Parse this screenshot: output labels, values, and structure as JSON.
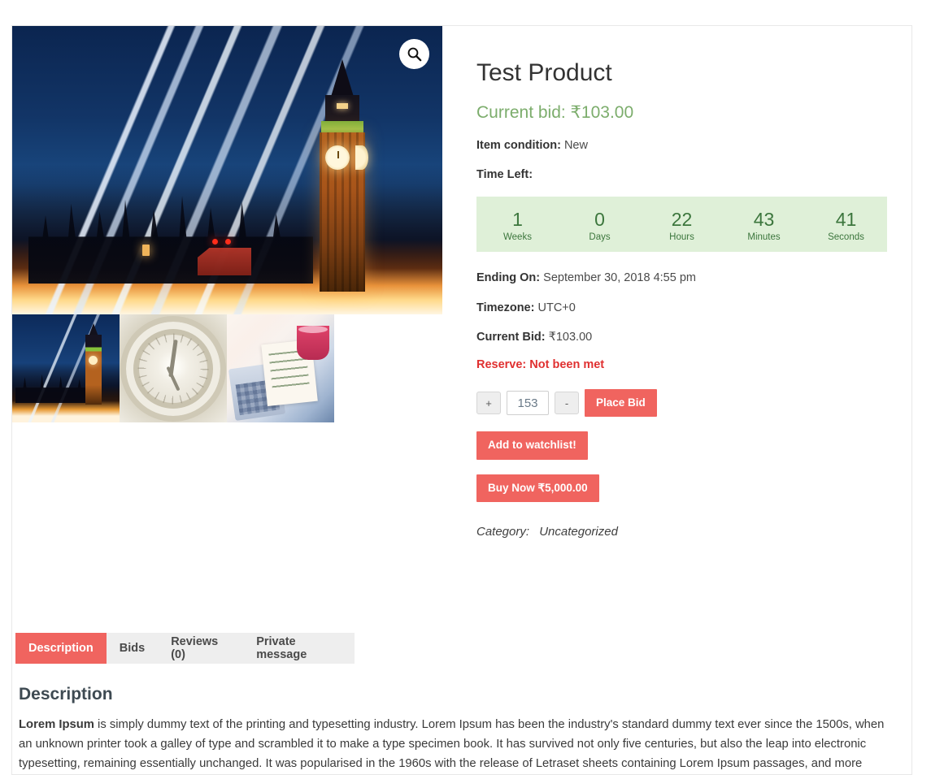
{
  "product": {
    "title": "Test Product",
    "current_bid_heading": "Current bid: ₹103.00",
    "condition_label": "Item condition:",
    "condition_value": "New",
    "time_left_label": "Time Left:",
    "ending_on_label": "Ending On:",
    "ending_on_value": "September 30, 2018 4:55 pm",
    "timezone_label": "Timezone:",
    "timezone_value": "UTC+0",
    "current_bid_label": "Current Bid:",
    "current_bid_value": "₹103.00",
    "reserve_text": "Reserve: Not been met",
    "category_label": "Category:",
    "category_value": "Uncategorized"
  },
  "countdown": {
    "units": [
      {
        "value": "1",
        "label": "Weeks"
      },
      {
        "value": "0",
        "label": "Days"
      },
      {
        "value": "22",
        "label": "Hours"
      },
      {
        "value": "43",
        "label": "Minutes"
      },
      {
        "value": "41",
        "label": "Seconds"
      }
    ]
  },
  "bid_form": {
    "increment_label": "+",
    "decrement_label": "-",
    "quantity_value": "153",
    "place_bid_label": "Place Bid",
    "watchlist_label": "Add to watchlist!",
    "buy_now_label": "Buy Now ₹5,000.00"
  },
  "gallery": {
    "zoom_icon": "search-icon",
    "main_image_alt": "Big Ben and Houses of Parliament at night with light trails",
    "thumbnails": [
      {
        "alt": "Big Ben night light trails"
      },
      {
        "alt": "Clock face close-up"
      },
      {
        "alt": "Business plan notebook with calculator and coffee"
      },
      {
        "alt": ""
      }
    ]
  },
  "tabs": [
    {
      "label": "Description",
      "active": true
    },
    {
      "label": "Bids",
      "active": false
    },
    {
      "label": "Reviews (0)",
      "active": false
    },
    {
      "label": "Private message",
      "active": false
    }
  ],
  "description_panel": {
    "heading": "Description",
    "lead": "Lorem Ipsum",
    "body": " is simply dummy text of the printing and typesetting industry. Lorem Ipsum has been the industry's standard dummy text ever since the 1500s, when an unknown printer took a galley of type and scrambled it to make a type specimen book. It has survived not only five centuries, but also the leap into electronic typesetting, remaining essentially unchanged. It was popularised in the 1960s with the release of Letraset sheets containing Lorem Ipsum passages, and more"
  },
  "colors": {
    "accent": "#f0645f",
    "countdown_bg": "#dff0d8",
    "countdown_text": "#3c763d",
    "bid_green": "#7cad6c",
    "reserve_red": "#e03030",
    "tab_inactive_bg": "#eeeeee"
  }
}
